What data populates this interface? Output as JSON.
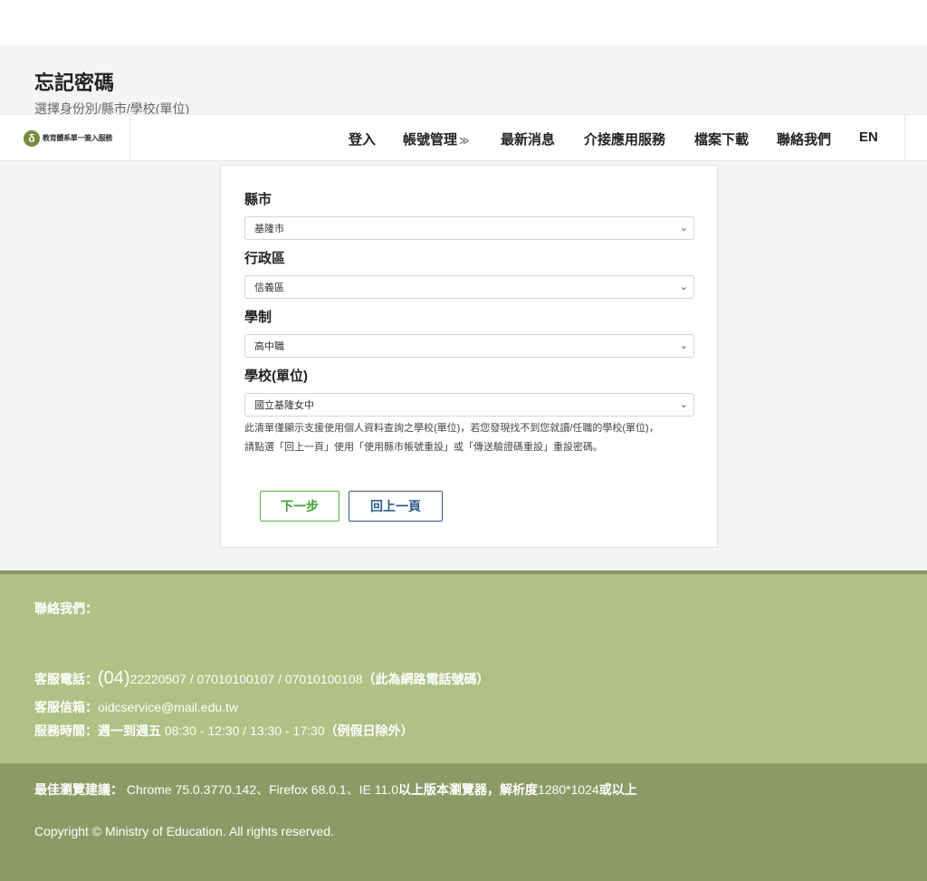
{
  "page": {
    "title": "忘記密碼",
    "subtitle": "選擇身份別/縣市/學校(單位)"
  },
  "navbar": {
    "logo_mark": "δ",
    "logo_text": "教育體系單一簽入服務",
    "items": [
      {
        "label": "登入"
      },
      {
        "label": "帳號管理",
        "chevron": "≫"
      },
      {
        "label": "最新消息"
      },
      {
        "label": "介接應用服務"
      },
      {
        "label": "檔案下載"
      },
      {
        "label": "聯絡我們"
      },
      {
        "label": "EN"
      }
    ]
  },
  "form": {
    "fields": [
      {
        "label": "縣市",
        "value": "基隆市"
      },
      {
        "label": "行政區",
        "value": "信義區"
      },
      {
        "label": "學制",
        "value": "高中職"
      },
      {
        "label": "學校(單位)",
        "value": "國立基隆女中"
      }
    ],
    "select_chevron": "⌄",
    "notice_line1": "此清單僅顯示支援使用個人資料查詢之學校(單位)，若您發現找不到您就讀/任職的學校(單位)，",
    "notice_line2": "請點選「回上一頁」使用「使用縣市帳號重設」或「傳送驗證碼重設」重設密碼。",
    "next_label": "下一步",
    "back_label": "回上一頁"
  },
  "footer": {
    "contact_heading": "聯絡我們：",
    "phone_label": "客服電話：",
    "phone_area": "(04)",
    "phone_numbers": "22220507 / 07010100107 / 07010100108",
    "phone_note": "（此為網路電話號碼）",
    "email_label": "客服信箱：",
    "email": "oidcservice@mail.edu.tw",
    "hours_label": "服務時間：",
    "hours_days": "週一到週五",
    "hours_time": " 08:30 - 12:30 / 13:30 - 17:30",
    "hours_note": "（例假日除外）",
    "browser_label": "最佳瀏覽建議：",
    "browser_versions": " Chrome 75.0.3770.142、Firefox 68.0.1、IE 11.0",
    "browser_suffix": "以上版本瀏覽器，解析度",
    "browser_resolution": "1280*1024",
    "browser_end": "或以上",
    "copyright": "Copyright © Ministry of Education. All rights reserved."
  }
}
